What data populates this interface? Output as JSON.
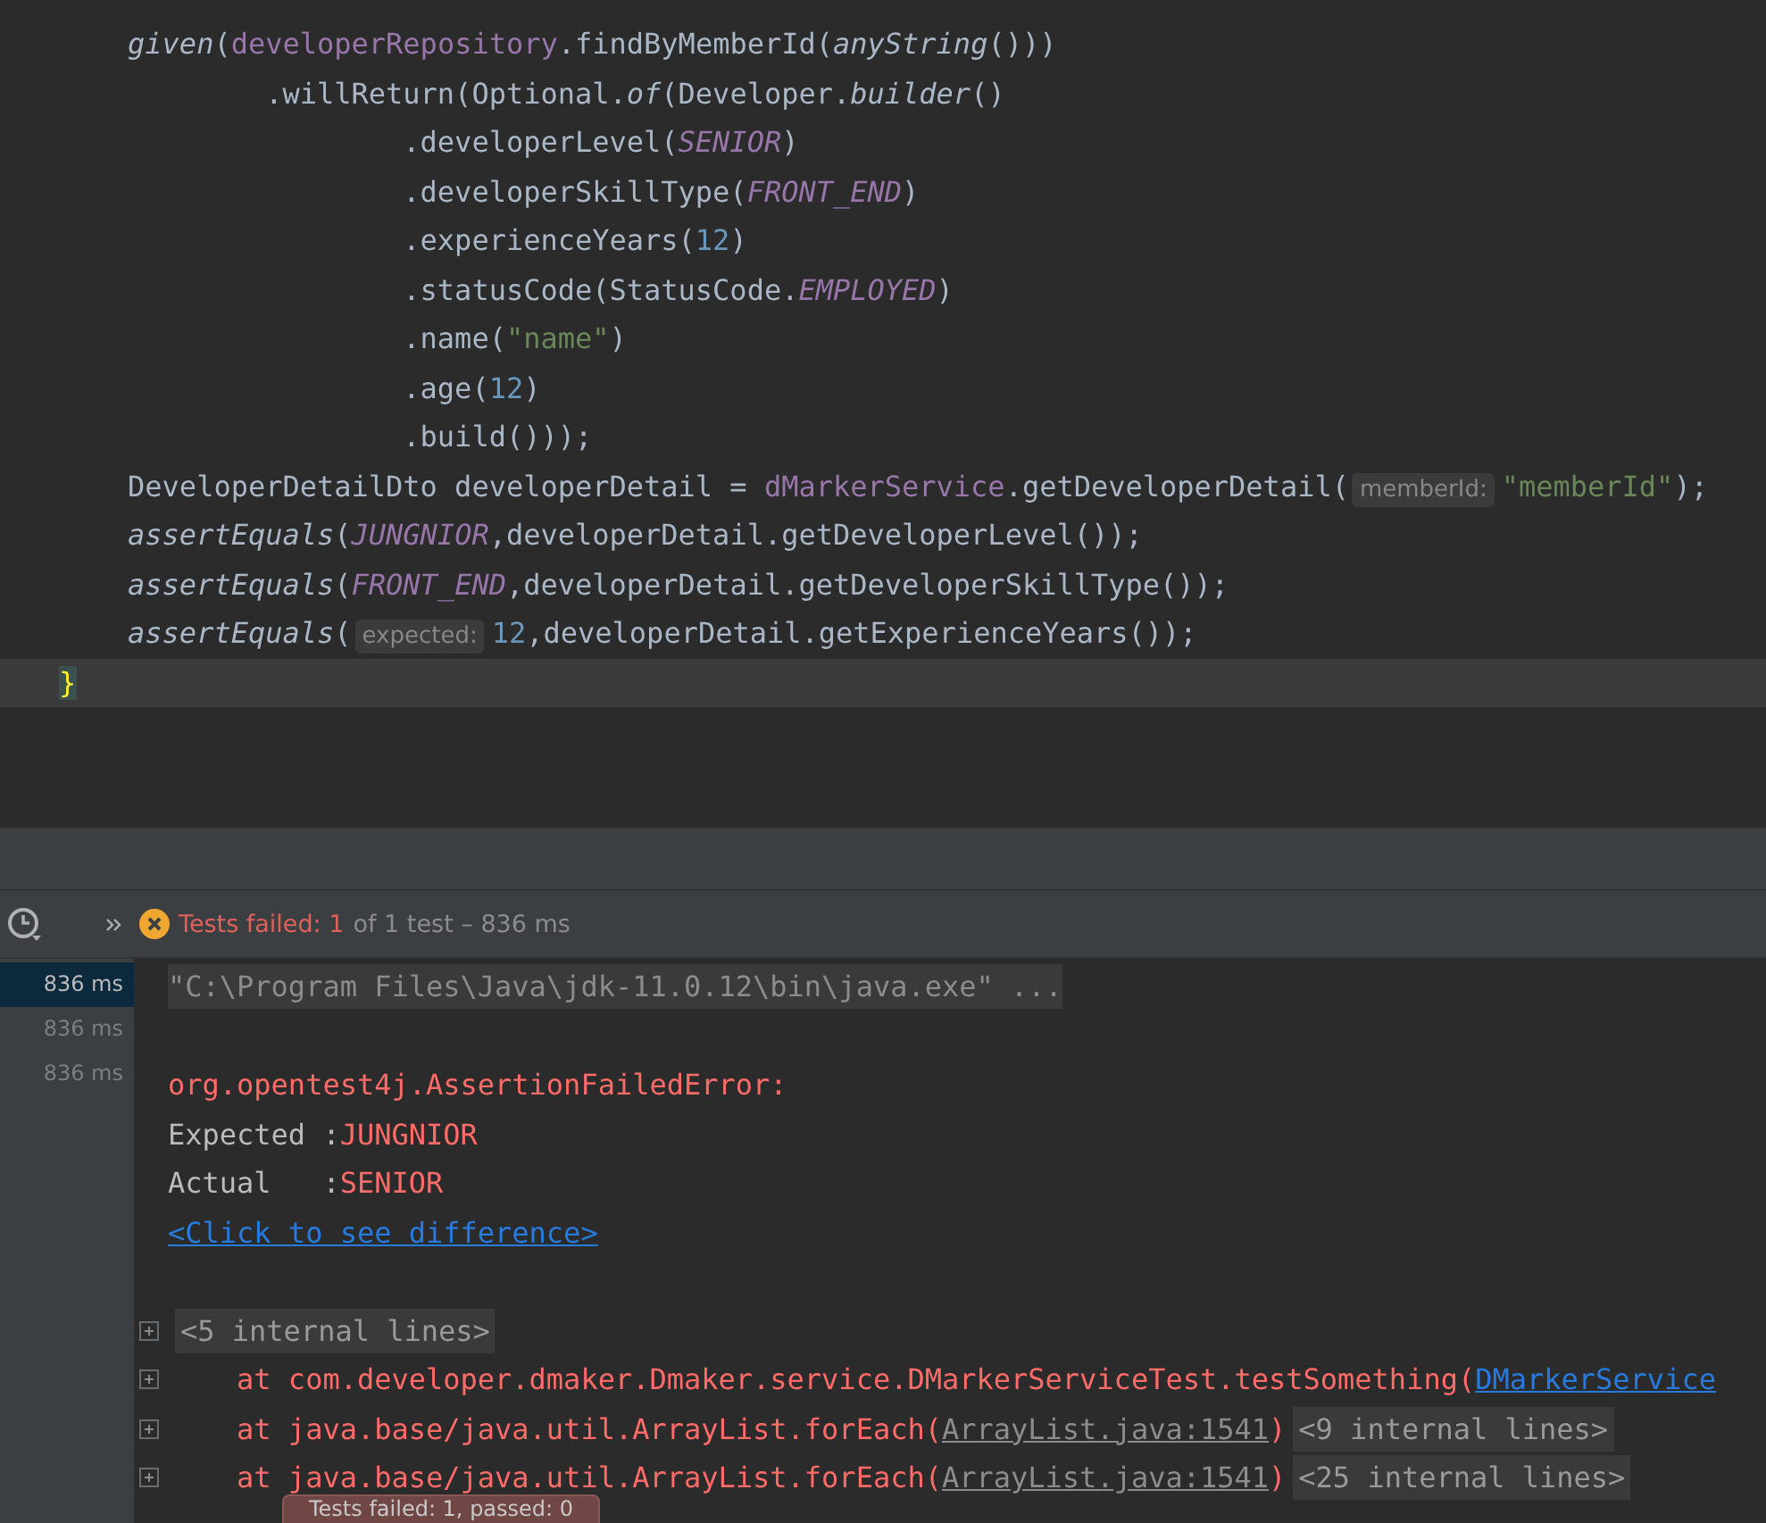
{
  "editor": {
    "lines": [
      {
        "current": false,
        "tokens": [
          {
            "kind": "method",
            "text": "    given"
          },
          {
            "kind": "plain",
            "text": "("
          },
          {
            "kind": "field",
            "text": "developerRepository"
          },
          {
            "kind": "plain",
            "text": ".findByMemberId("
          },
          {
            "kind": "method",
            "text": "anyString"
          },
          {
            "kind": "plain",
            "text": "()))"
          }
        ]
      },
      {
        "current": false,
        "tokens": [
          {
            "kind": "plain",
            "text": "            .willReturn(Optional."
          },
          {
            "kind": "method",
            "text": "of"
          },
          {
            "kind": "plain",
            "text": "(Developer."
          },
          {
            "kind": "method",
            "text": "builder"
          },
          {
            "kind": "plain",
            "text": "()"
          }
        ]
      },
      {
        "current": false,
        "tokens": [
          {
            "kind": "plain",
            "text": "                    .developerLevel("
          },
          {
            "kind": "static",
            "text": "SENIOR"
          },
          {
            "kind": "plain",
            "text": ")"
          }
        ]
      },
      {
        "current": false,
        "tokens": [
          {
            "kind": "plain",
            "text": "                    .developerSkillType("
          },
          {
            "kind": "static",
            "text": "FRONT_END"
          },
          {
            "kind": "plain",
            "text": ")"
          }
        ]
      },
      {
        "current": false,
        "tokens": [
          {
            "kind": "plain",
            "text": "                    .experienceYears("
          },
          {
            "kind": "number",
            "text": "12"
          },
          {
            "kind": "plain",
            "text": ")"
          }
        ]
      },
      {
        "current": false,
        "tokens": [
          {
            "kind": "plain",
            "text": "                    .statusCode(StatusCode."
          },
          {
            "kind": "static",
            "text": "EMPLOYED"
          },
          {
            "kind": "plain",
            "text": ")"
          }
        ]
      },
      {
        "current": false,
        "tokens": [
          {
            "kind": "plain",
            "text": "                    .name("
          },
          {
            "kind": "string",
            "text": "\"name\""
          },
          {
            "kind": "plain",
            "text": ")"
          }
        ]
      },
      {
        "current": false,
        "tokens": [
          {
            "kind": "plain",
            "text": "                    .age("
          },
          {
            "kind": "number",
            "text": "12"
          },
          {
            "kind": "plain",
            "text": ")"
          }
        ]
      },
      {
        "current": false,
        "tokens": [
          {
            "kind": "plain",
            "text": "                    .build()));"
          }
        ]
      },
      {
        "current": false,
        "tokens": [
          {
            "kind": "plain",
            "text": "    DeveloperDetailDto developerDetail = "
          },
          {
            "kind": "field",
            "text": "dMarkerService"
          },
          {
            "kind": "plain",
            "text": ".getDeveloperDetail("
          },
          {
            "kind": "hint",
            "text": "memberId:"
          },
          {
            "kind": "string",
            "text": "\"memberId\""
          },
          {
            "kind": "plain",
            "text": ");"
          }
        ]
      },
      {
        "current": false,
        "tokens": [
          {
            "kind": "method",
            "text": "    assertEquals"
          },
          {
            "kind": "plain",
            "text": "("
          },
          {
            "kind": "static",
            "text": "JUNGNIOR"
          },
          {
            "kind": "plain",
            "text": ",developerDetail.getDeveloperLevel());"
          }
        ]
      },
      {
        "current": false,
        "tokens": [
          {
            "kind": "method",
            "text": "    assertEquals"
          },
          {
            "kind": "plain",
            "text": "("
          },
          {
            "kind": "static",
            "text": "FRONT_END"
          },
          {
            "kind": "plain",
            "text": ",developerDetail.getDeveloperSkillType());"
          }
        ]
      },
      {
        "current": false,
        "tokens": [
          {
            "kind": "method",
            "text": "    assertEquals"
          },
          {
            "kind": "plain",
            "text": "("
          },
          {
            "kind": "hint",
            "text": "expected:"
          },
          {
            "kind": "number",
            "text": "12"
          },
          {
            "kind": "plain",
            "text": ",developerDetail.getExperienceYears());"
          }
        ]
      },
      {
        "current": true,
        "tokens": [
          {
            "kind": "brace",
            "text": "}"
          }
        ]
      }
    ]
  },
  "test_bar": {
    "failed_label": "Tests failed: 1",
    "summary": "of 1 test – 836 ms"
  },
  "timings": [
    {
      "text": "836 ms",
      "selected": true
    },
    {
      "text": "836 ms",
      "selected": false
    },
    {
      "text": "836 ms",
      "selected": false
    }
  ],
  "console": {
    "lines": [
      {
        "foldable": false,
        "blank_before": false,
        "tokens": [
          {
            "kind": "cmd",
            "text": "\"C:\\Program Files\\Java\\jdk-11.0.12\\bin\\java.exe\" ..."
          }
        ]
      },
      {
        "foldable": false,
        "blank_before": true,
        "tokens": [
          {
            "kind": "error",
            "text": "org.opentest4j.AssertionFailedError:"
          }
        ]
      },
      {
        "foldable": false,
        "blank_before": false,
        "tokens": [
          {
            "kind": "plain",
            "text": "Expected :"
          },
          {
            "kind": "error",
            "text": "JUNGNIOR"
          }
        ]
      },
      {
        "foldable": false,
        "blank_before": false,
        "tokens": [
          {
            "kind": "plain",
            "text": "Actual   :"
          },
          {
            "kind": "error",
            "text": "SENIOR"
          }
        ]
      },
      {
        "foldable": false,
        "blank_before": false,
        "tokens": [
          {
            "kind": "link",
            "text": "<Click to see difference>"
          }
        ]
      },
      {
        "foldable": true,
        "blank_before": true,
        "tokens": [
          {
            "kind": "fold",
            "text": "<5 internal lines>"
          }
        ]
      },
      {
        "foldable": true,
        "blank_before": false,
        "tokens": [
          {
            "kind": "error",
            "text": "    at com.developer.dmaker.Dmaker.service.DMarkerServiceTest.testSomething("
          },
          {
            "kind": "link",
            "text": "DMarkerService"
          }
        ]
      },
      {
        "foldable": true,
        "blank_before": false,
        "tokens": [
          {
            "kind": "error",
            "text": "    at java.base/java.util.ArrayList.forEach("
          },
          {
            "kind": "filelink",
            "text": "ArrayList.java:1541"
          },
          {
            "kind": "error",
            "text": ")"
          },
          {
            "kind": "fold",
            "text": "<9 internal lines>"
          }
        ]
      },
      {
        "foldable": true,
        "blank_before": false,
        "tokens": [
          {
            "kind": "error",
            "text": "    at java.base/java.util.ArrayList.forEach("
          },
          {
            "kind": "filelink",
            "text": "ArrayList.java:1541"
          },
          {
            "kind": "error",
            "text": ")"
          },
          {
            "kind": "fold",
            "text": "<25 internal lines>"
          }
        ]
      }
    ]
  },
  "toast": {
    "text": "Tests failed: 1, passed: 0"
  }
}
